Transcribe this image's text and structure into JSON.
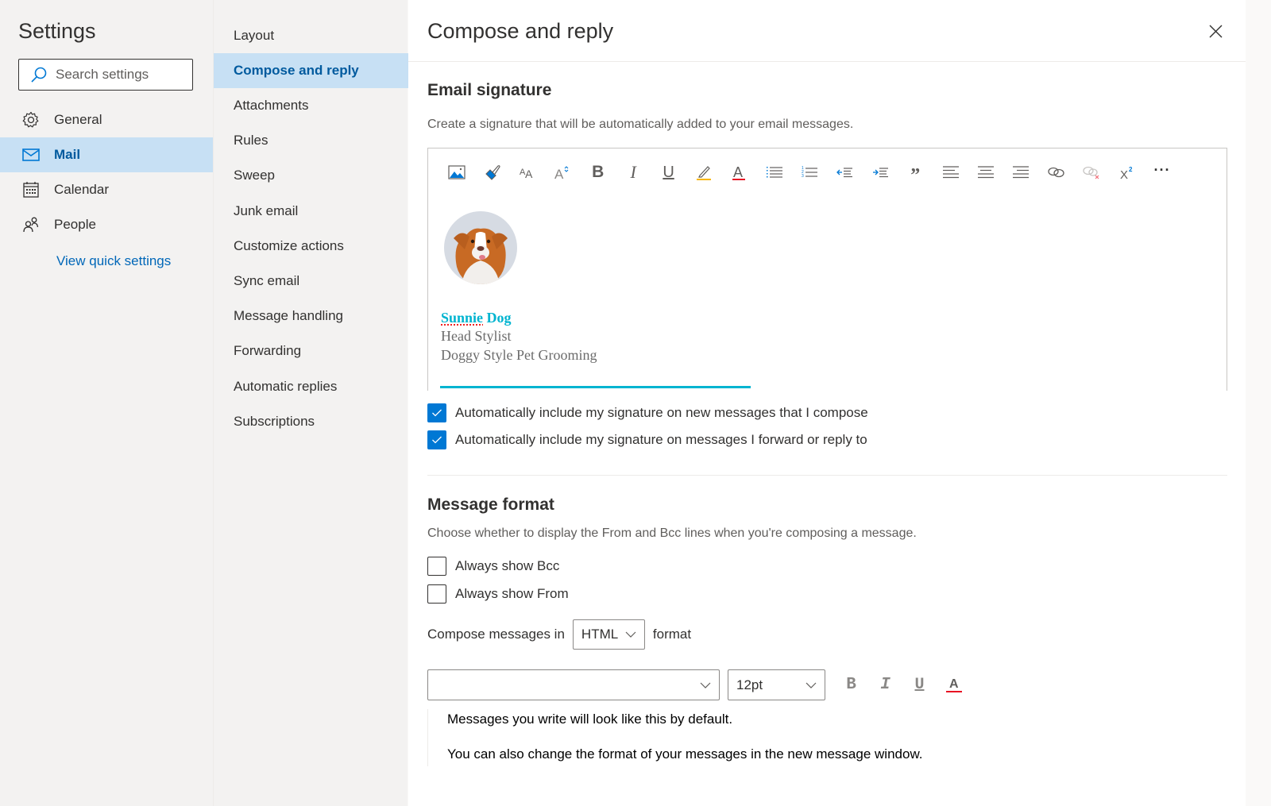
{
  "settings_nav": {
    "title": "Settings",
    "search_placeholder": "Search settings",
    "items": [
      {
        "label": "General",
        "icon": "gear-icon",
        "active": false
      },
      {
        "label": "Mail",
        "icon": "mail-icon",
        "active": true
      },
      {
        "label": "Calendar",
        "icon": "calendar-icon",
        "active": false
      },
      {
        "label": "People",
        "icon": "people-icon",
        "active": false
      }
    ],
    "quick_settings_link": "View quick settings"
  },
  "mail_nav": {
    "items": [
      {
        "label": "Layout",
        "active": false
      },
      {
        "label": "Compose and reply",
        "active": true
      },
      {
        "label": "Attachments",
        "active": false
      },
      {
        "label": "Rules",
        "active": false
      },
      {
        "label": "Sweep",
        "active": false
      },
      {
        "label": "Junk email",
        "active": false
      },
      {
        "label": "Customize actions",
        "active": false
      },
      {
        "label": "Sync email",
        "active": false
      },
      {
        "label": "Message handling",
        "active": false
      },
      {
        "label": "Forwarding",
        "active": false
      },
      {
        "label": "Automatic replies",
        "active": false
      },
      {
        "label": "Subscriptions",
        "active": false
      }
    ]
  },
  "main": {
    "title": "Compose and reply",
    "close_icon": "close-icon",
    "email_signature": {
      "title": "Email signature",
      "description": "Create a signature that will be automatically added to your email messages.",
      "toolbar": [
        "insert-picture-icon",
        "format-painter-icon",
        "font-size-icon",
        "font-grow-icon",
        "bold-icon",
        "italic-icon",
        "underline-icon",
        "highlight-icon",
        "font-color-icon",
        "bulleted-list-icon",
        "numbered-list-icon",
        "decrease-indent-icon",
        "increase-indent-icon",
        "quote-icon",
        "align-left-icon",
        "align-center-icon",
        "align-right-icon",
        "insert-link-icon",
        "remove-link-icon",
        "superscript-icon",
        "more-options-icon"
      ],
      "signature": {
        "first_name": "Sunnie",
        "last_name": "Dog",
        "title": "Head Stylist",
        "company": "Doggy Style Pet Grooming",
        "name_color": "#00b4d0"
      },
      "options": [
        {
          "label": "Automatically include my signature on new messages that I compose",
          "checked": true
        },
        {
          "label": "Automatically include my signature on messages I forward or reply to",
          "checked": true
        }
      ]
    },
    "message_format": {
      "title": "Message format",
      "description": "Choose whether to display the From and Bcc lines when you're composing a message.",
      "options": [
        {
          "label": "Always show Bcc",
          "checked": false
        },
        {
          "label": "Always show From",
          "checked": false
        }
      ],
      "compose_prefix": "Compose messages in",
      "compose_format": "HTML",
      "compose_suffix": "format",
      "font_name": "",
      "font_size": "12pt",
      "preview_line1": "Messages you write will look like this by default.",
      "preview_line2": "You can also change the format of your messages in the new message window."
    }
  },
  "colors": {
    "accent": "#0078d4",
    "nav_selected_bg": "#c7e0f4",
    "nav_selected_text": "#005a9e",
    "link": "#0067b8"
  }
}
